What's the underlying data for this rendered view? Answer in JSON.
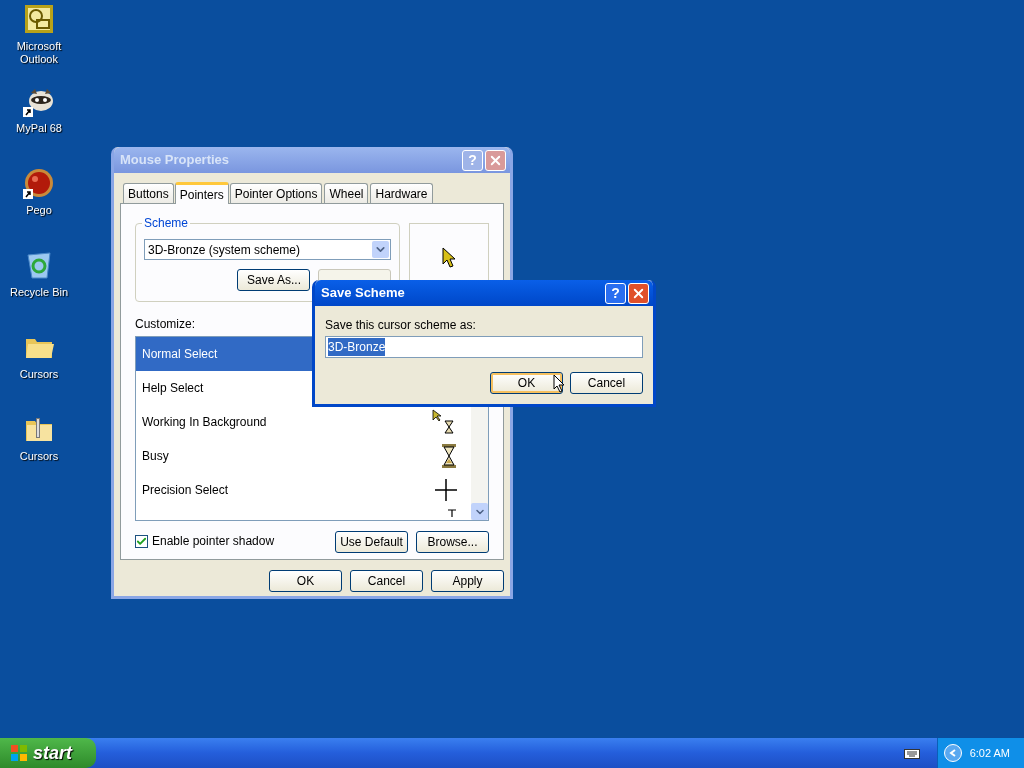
{
  "desktop_icons": [
    {
      "label": "Microsoft Outlook",
      "kind": "outlook",
      "shortcut": false
    },
    {
      "label": "MyPal 68",
      "kind": "raccoon",
      "shortcut": true
    },
    {
      "label": "Pego",
      "kind": "ball",
      "shortcut": true
    },
    {
      "label": "Recycle Bin",
      "kind": "recycle",
      "shortcut": false
    },
    {
      "label": "Cursors",
      "kind": "folder",
      "shortcut": false
    },
    {
      "label": "Cursors",
      "kind": "zip",
      "shortcut": false
    }
  ],
  "mouse_properties": {
    "title": "Mouse Properties",
    "active": false,
    "help": "?",
    "tabs": [
      {
        "label": "Buttons",
        "selected": false
      },
      {
        "label": "Pointers",
        "selected": true
      },
      {
        "label": "Pointer Options",
        "selected": false
      },
      {
        "label": "Wheel",
        "selected": false
      },
      {
        "label": "Hardware",
        "selected": false
      }
    ],
    "scheme": {
      "group_label": "Scheme",
      "value": "3D-Bronze (system scheme)",
      "buttons": [
        {
          "label": "Save As...",
          "disabled": false
        },
        {
          "disabled": true
        }
      ]
    },
    "customize_label": "Customize:",
    "pointers": [
      {
        "name": "Normal Select",
        "selected": true
      },
      {
        "name": "Help Select",
        "selected": false
      },
      {
        "name": "Working In Background",
        "selected": false,
        "kind": "working"
      },
      {
        "name": "Busy",
        "selected": false,
        "kind": "busy"
      },
      {
        "name": "Precision Select",
        "selected": false,
        "kind": "cross"
      },
      {
        "selected": false,
        "kind": "text"
      }
    ],
    "shadow": {
      "label": "Enable pointer shadow",
      "checked": true
    },
    "list_buttons": [
      "Use Default",
      "Browse..."
    ],
    "footer_buttons": [
      "OK",
      "Cancel",
      "Apply"
    ]
  },
  "save_scheme": {
    "title": "Save Scheme",
    "active": true,
    "help": "?",
    "prompt": "Save this cursor scheme as:",
    "value": "3D-Bronze",
    "value_selected": true,
    "buttons": [
      {
        "label": "OK",
        "default": true
      },
      {
        "label": "Cancel",
        "default": false
      }
    ]
  },
  "taskbar": {
    "start": "start",
    "clock": "6:02 AM"
  }
}
